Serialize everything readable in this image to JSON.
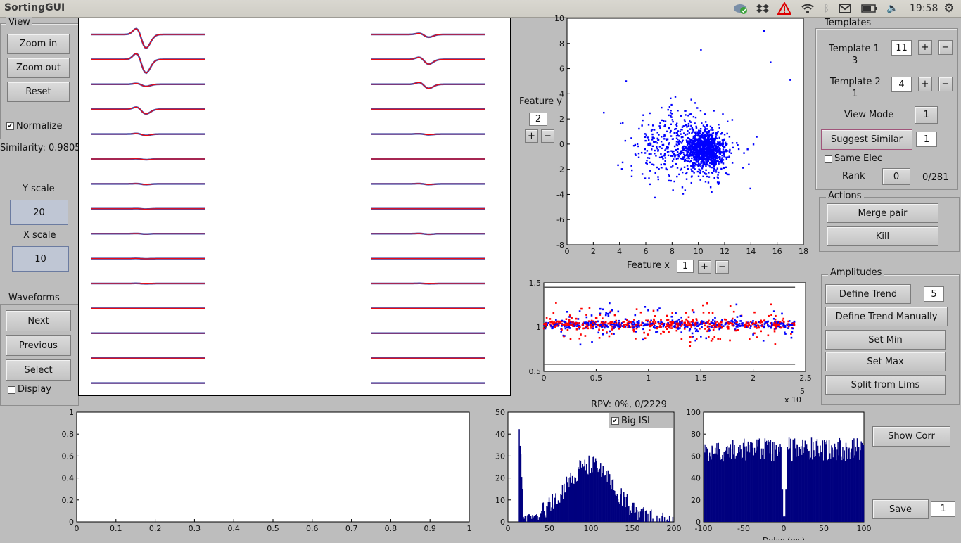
{
  "window": {
    "title": "SortingGUI",
    "clock": "19:58"
  },
  "tray_icons": [
    "cloud-sync-icon",
    "dropbox-icon",
    "warning-icon",
    "wifi-icon",
    "bluetooth-icon",
    "mail-icon",
    "battery-icon",
    "volume-icon"
  ],
  "view": {
    "title": "View",
    "zoom_in": "Zoom in",
    "zoom_out": "Zoom out",
    "reset": "Reset",
    "normalize": "Normalize"
  },
  "similarity": "Similarity: 0.9805",
  "scales": {
    "y_label": "Y scale",
    "y_value": "20",
    "x_label": "X scale",
    "x_value": "10"
  },
  "waveforms": {
    "title": "Waveforms",
    "next": "Next",
    "previous": "Previous",
    "select": "Select",
    "display": "Display"
  },
  "templates": {
    "title": "Templates",
    "t1_label": "Template 1",
    "t1_value": "11",
    "t1_sub": "3",
    "t2_label": "Template 2",
    "t2_value": "4",
    "t2_sub": "1",
    "view_mode_label": "View Mode",
    "view_mode_value": "1",
    "suggest_label": "Suggest Similar",
    "suggest_value": "1",
    "same_elec": "Same Elec",
    "rank_label": "Rank",
    "rank_value": "0",
    "rank_count": "0/281",
    "plus": "+",
    "minus": "−"
  },
  "actions": {
    "title": "Actions",
    "merge": "Merge pair",
    "kill": "Kill"
  },
  "amplitudes": {
    "title": "Amplitudes",
    "define_trend": "Define Trend",
    "trend_value": "5",
    "define_manual": "Define Trend Manually",
    "set_min": "Set Min",
    "set_max": "Set Max",
    "split": "Split from Lims"
  },
  "feature": {
    "y_label": "Feature y",
    "y_value": "2",
    "x_label": "Feature x",
    "x_value": "1"
  },
  "rpv": "RPV: 0%, 0/2229",
  "big_isi": "Big ISI",
  "show_corr": "Show Corr",
  "save": {
    "label": "Save",
    "value": "1"
  },
  "colors": {
    "blue": "#0000ff",
    "red": "#ff0000",
    "navy": "#00007f",
    "panel": "#bdbdbd"
  },
  "chart_data": [
    {
      "type": "scatter",
      "name": "feature-scatter",
      "xlim": [
        0,
        18
      ],
      "ylim": [
        -8,
        10
      ],
      "xticks": [
        "0",
        "2",
        "4",
        "6",
        "8",
        "10",
        "12",
        "14",
        "16",
        "18"
      ],
      "yticks": [
        "-8",
        "-6",
        "-4",
        "-2",
        "0",
        "2",
        "4",
        "6",
        "8",
        "10"
      ],
      "cluster_center": [
        10.5,
        -0.5
      ],
      "points_approx": 2229
    },
    {
      "type": "scatter",
      "name": "amplitude-vs-time",
      "xlim": [
        0,
        2.5
      ],
      "ylim": [
        0.5,
        1.5
      ],
      "xticks": [
        "0",
        "0.5",
        "1",
        "1.5",
        "2",
        "2.5"
      ],
      "yticks": [
        "0.5",
        "1",
        "1.5"
      ],
      "x_exponent": "x 10",
      "x_exponent_power": "5",
      "limit_lines": [
        1.45,
        0.58
      ]
    },
    {
      "type": "line",
      "name": "empty-axes",
      "xlim": [
        0,
        1
      ],
      "ylim": [
        0,
        1
      ],
      "xticks": [
        "0",
        "0.1",
        "0.2",
        "0.3",
        "0.4",
        "0.5",
        "0.6",
        "0.7",
        "0.8",
        "0.9",
        "1"
      ],
      "yticks": [
        "0",
        "0.2",
        "0.4",
        "0.6",
        "0.8",
        "1"
      ]
    },
    {
      "type": "bar",
      "name": "isi-histogram",
      "xlim": [
        0,
        200
      ],
      "ylim": [
        0,
        50
      ],
      "xticks": [
        "0",
        "50",
        "100",
        "150",
        "200"
      ],
      "yticks": [
        "0",
        "10",
        "20",
        "30",
        "40",
        "50"
      ]
    },
    {
      "type": "bar",
      "name": "cross-correlogram",
      "xlim": [
        -100,
        100
      ],
      "ylim": [
        0,
        100
      ],
      "xticks": [
        "-100",
        "-50",
        "0",
        "50",
        "100"
      ],
      "yticks": [
        "0",
        "20",
        "40",
        "60",
        "80",
        "100"
      ],
      "xlabel": "Delay (ms)"
    }
  ]
}
